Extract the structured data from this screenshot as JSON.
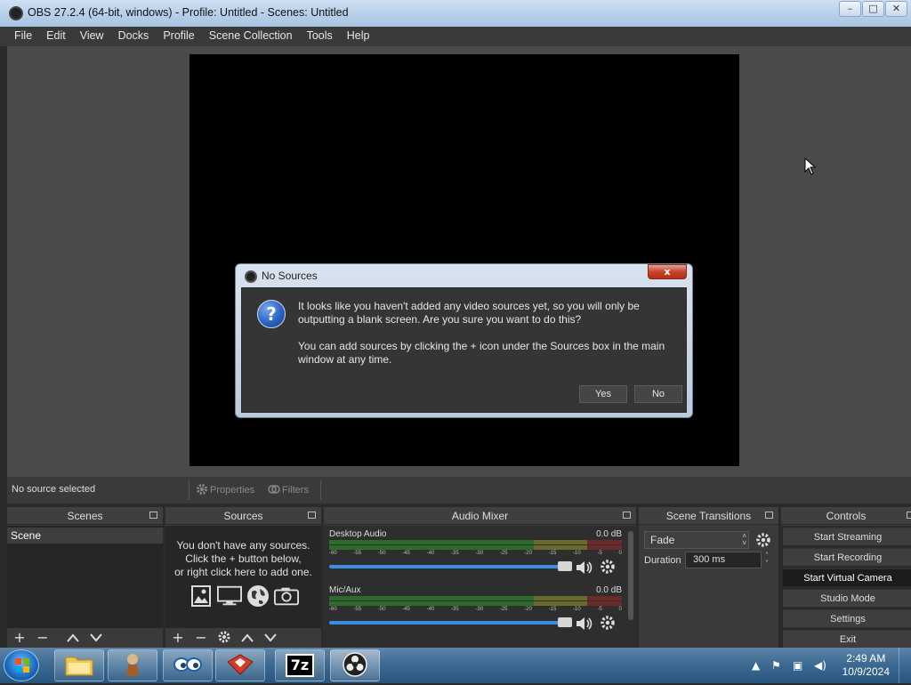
{
  "window": {
    "title": "OBS 27.2.4 (64-bit, windows) - Profile: Untitled - Scenes: Untitled",
    "minimize": "–",
    "maximize": "□",
    "close": "✕"
  },
  "menu": [
    "File",
    "Edit",
    "View",
    "Docks",
    "Profile",
    "Scene Collection",
    "Tools",
    "Help"
  ],
  "source_toolbar": {
    "status": "No source selected",
    "properties": "Properties",
    "filters": "Filters"
  },
  "docks": {
    "scenes": {
      "title": "Scenes",
      "items": [
        "Scene"
      ]
    },
    "sources": {
      "title": "Sources",
      "empty_line1": "You don't have any sources.",
      "empty_line2": "Click the + button below,",
      "empty_line3": "or right click here to add one."
    },
    "mixer": {
      "title": "Audio Mixer",
      "channels": [
        {
          "name": "Desktop Audio",
          "level": "0.0 dB"
        },
        {
          "name": "Mic/Aux",
          "level": "0.0 dB"
        }
      ],
      "ticks": [
        "-60",
        "-55",
        "-50",
        "-45",
        "-40",
        "-35",
        "-30",
        "-25",
        "-20",
        "-15",
        "-10",
        "-5",
        "0"
      ]
    },
    "transitions": {
      "title": "Scene Transitions",
      "selected": "Fade",
      "duration_label": "Duration",
      "duration_value": "300 ms"
    },
    "controls": {
      "title": "Controls",
      "buttons": [
        "Start Streaming",
        "Start Recording",
        "Start Virtual Camera",
        "Studio Mode",
        "Settings",
        "Exit"
      ]
    }
  },
  "dialog": {
    "title": "No Sources",
    "close": "x",
    "para1": "It looks like you haven't added any video sources yet, so you will only be outputting a blank screen. Are you sure you want to do this?",
    "para2": "You can add sources by clicking the + icon under the Sources box in the main window at any time.",
    "yes": "Yes",
    "no": "No",
    "icon": "?"
  },
  "taskbar": {
    "time": "2:49 AM",
    "date": "10/9/2024",
    "apps": [
      "windows-explorer",
      "app-2",
      "app-3",
      "app-4",
      "7-zip",
      "obs"
    ],
    "sevenzip_label": "7z"
  }
}
